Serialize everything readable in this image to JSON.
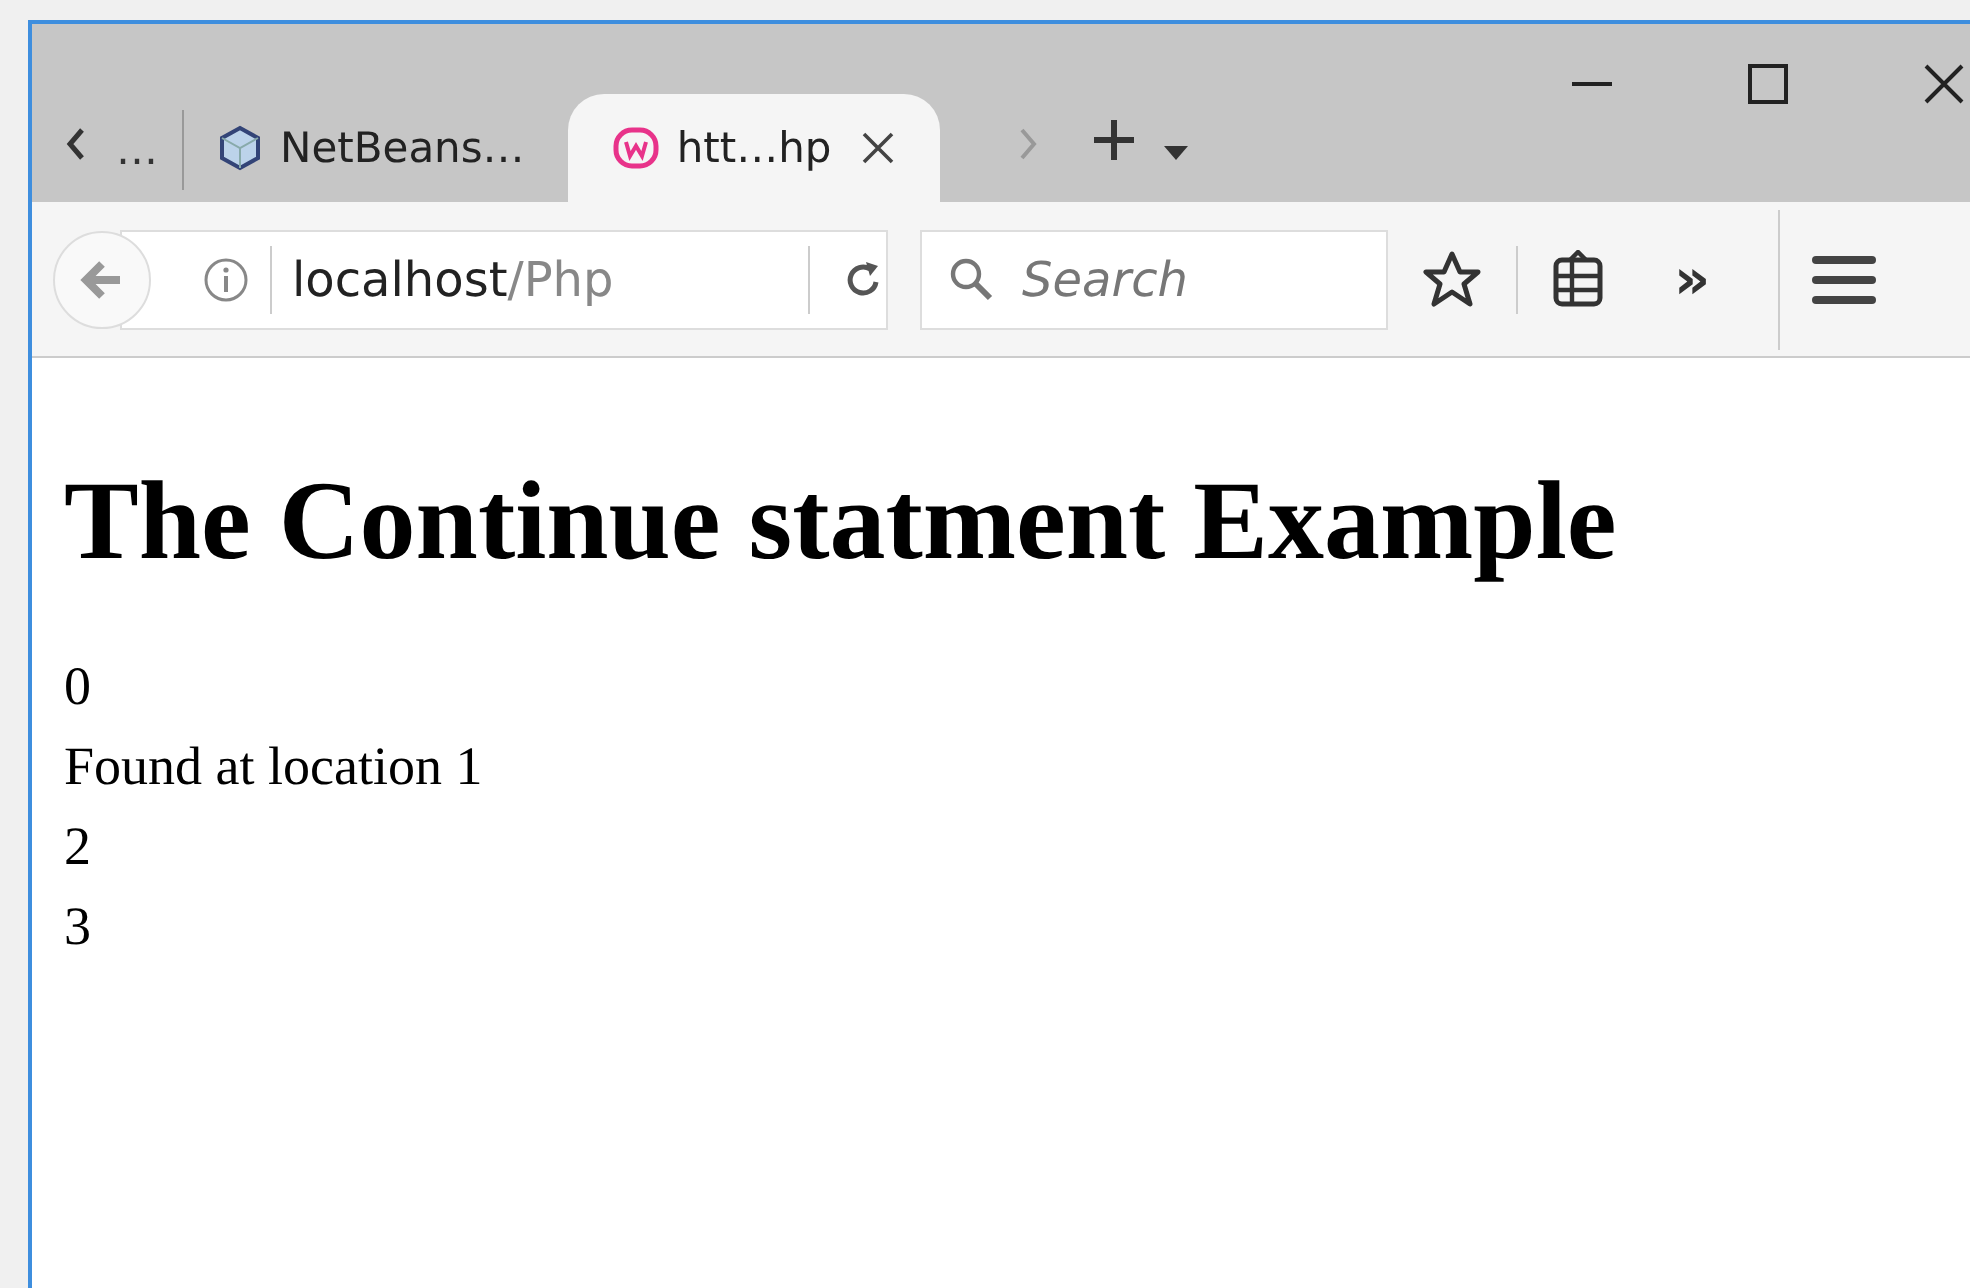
{
  "tabs": [
    {
      "kind": "overflow",
      "title": "…",
      "selected": false
    },
    {
      "kind": "cube",
      "title": "NetBeans…",
      "selected": false
    },
    {
      "kind": "badge",
      "title": "htt…hp",
      "selected": true
    }
  ],
  "address_bar": {
    "host": "localhost",
    "path": "/Php"
  },
  "search": {
    "placeholder": "Search"
  },
  "toolbar": {
    "overflow": "»"
  },
  "page": {
    "heading": "The Continue statment Example",
    "lines": [
      "0",
      "Found at location 1",
      "2",
      "3"
    ]
  }
}
